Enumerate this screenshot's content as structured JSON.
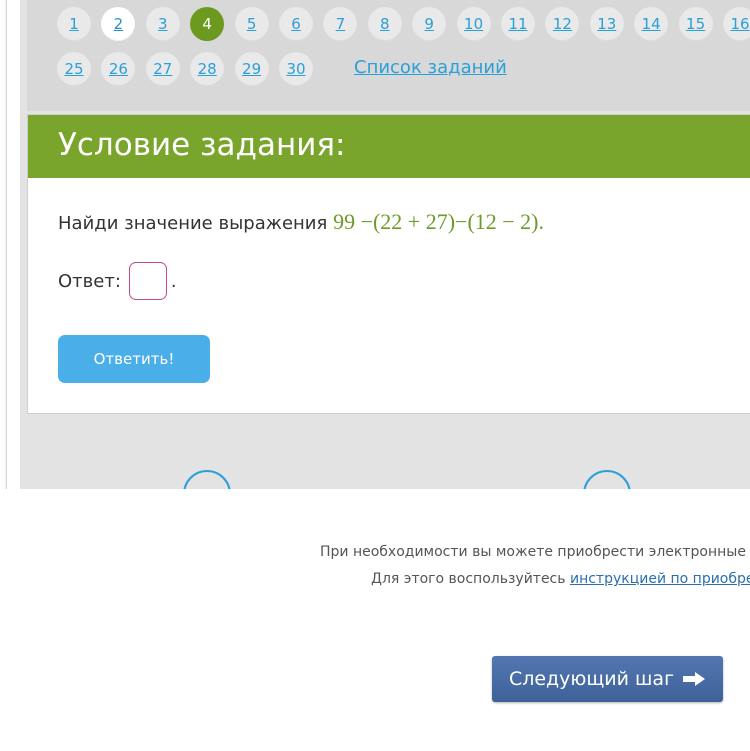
{
  "pagination": {
    "row1": [
      "1",
      "2",
      "3",
      "4",
      "5",
      "6",
      "7",
      "8",
      "9",
      "10",
      "11",
      "12",
      "13",
      "14",
      "15",
      "16"
    ],
    "row2": [
      "25",
      "26",
      "27",
      "28",
      "29",
      "30"
    ],
    "active": "4",
    "visited": "2",
    "task_list_link": "Список заданий"
  },
  "task": {
    "title": "Условие задания:",
    "question_prefix": "Найди значение выражения",
    "expression": "99 −(22 + 27)−(12 − 2).",
    "answer_label": "Ответ:",
    "answer_value": "",
    "answer_suffix": ".",
    "submit_label": "Ответить!"
  },
  "footer": {
    "line1": "При необходимости вы можете приобрести электронные",
    "line2_prefix": "Для этого воспользуйтесь",
    "line2_link": "инструкцией по приобре"
  },
  "next_step": {
    "label": "Следующий шаг",
    "icon": "arrow-right-icon"
  },
  "colors": {
    "accent_green": "#7aa52c",
    "active_page": "#6c9a1f",
    "link_blue": "#2a9fd8",
    "submit_blue": "#4aaee8",
    "next_button": "#4a6ea8",
    "input_border": "#c24b8f"
  }
}
